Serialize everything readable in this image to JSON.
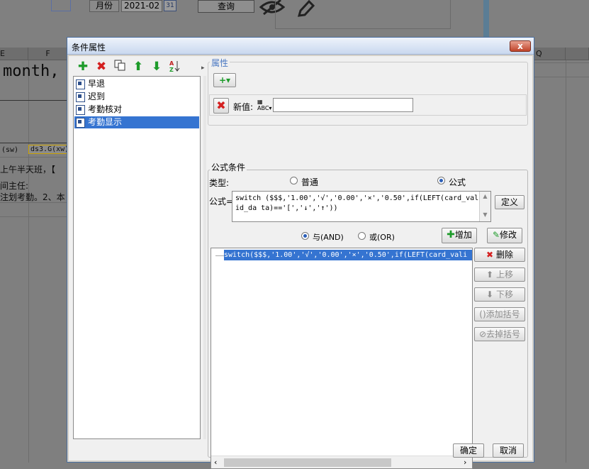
{
  "background": {
    "month_label": "月份",
    "month_value": "2021-02",
    "calendar_label": "31",
    "query_button": "查询",
    "columns": [
      "E",
      "F",
      "Q"
    ],
    "cell_month": "month,",
    "cell_sw": "(sw)",
    "cell_ds3": "ds3.G(xw)",
    "cell_line1": "上午半天班，【",
    "cell_line2": "间主任:",
    "cell_line3": "注划考勤。2、本"
  },
  "dialog": {
    "title": "条件属性",
    "close_label": "x",
    "conditions": [
      "早退",
      "迟到",
      "考勤核对",
      "考勤显示"
    ],
    "selected_index": 3,
    "properties_label": "属性",
    "add_property_label": "+▾",
    "new_value_label": "新值:",
    "new_value_input": "",
    "formula_group_label": "公式条件",
    "type_label": "类型:",
    "type_normal": "普通",
    "type_formula": "公式",
    "type_selected": "formula",
    "formula_label": "公式=",
    "formula_text": "switch ($$$,'1.00','√','0.00','×','0.50',if(LEFT(card_valid_da ta)=='[','↓','↑'))",
    "define_button": "定义",
    "and_label": "与(AND)",
    "or_label": "或(OR)",
    "logic_selected": "and",
    "add_button": "增加",
    "modify_button": "修改",
    "delete_button": "删除",
    "move_up_button": "上移",
    "move_down_button": "下移",
    "add_bracket_button": "添加括号",
    "remove_bracket_button": "去掉括号",
    "expression_items": [
      "switch($$$,'1.00','√','0.00','×','0.50',if(LEFT(card_vali"
    ],
    "ok_button": "确定",
    "cancel_button": "取消"
  },
  "colors": {
    "selection": "#3574d1",
    "add_green": "#1d9b2a",
    "delete_red": "#d42020"
  }
}
